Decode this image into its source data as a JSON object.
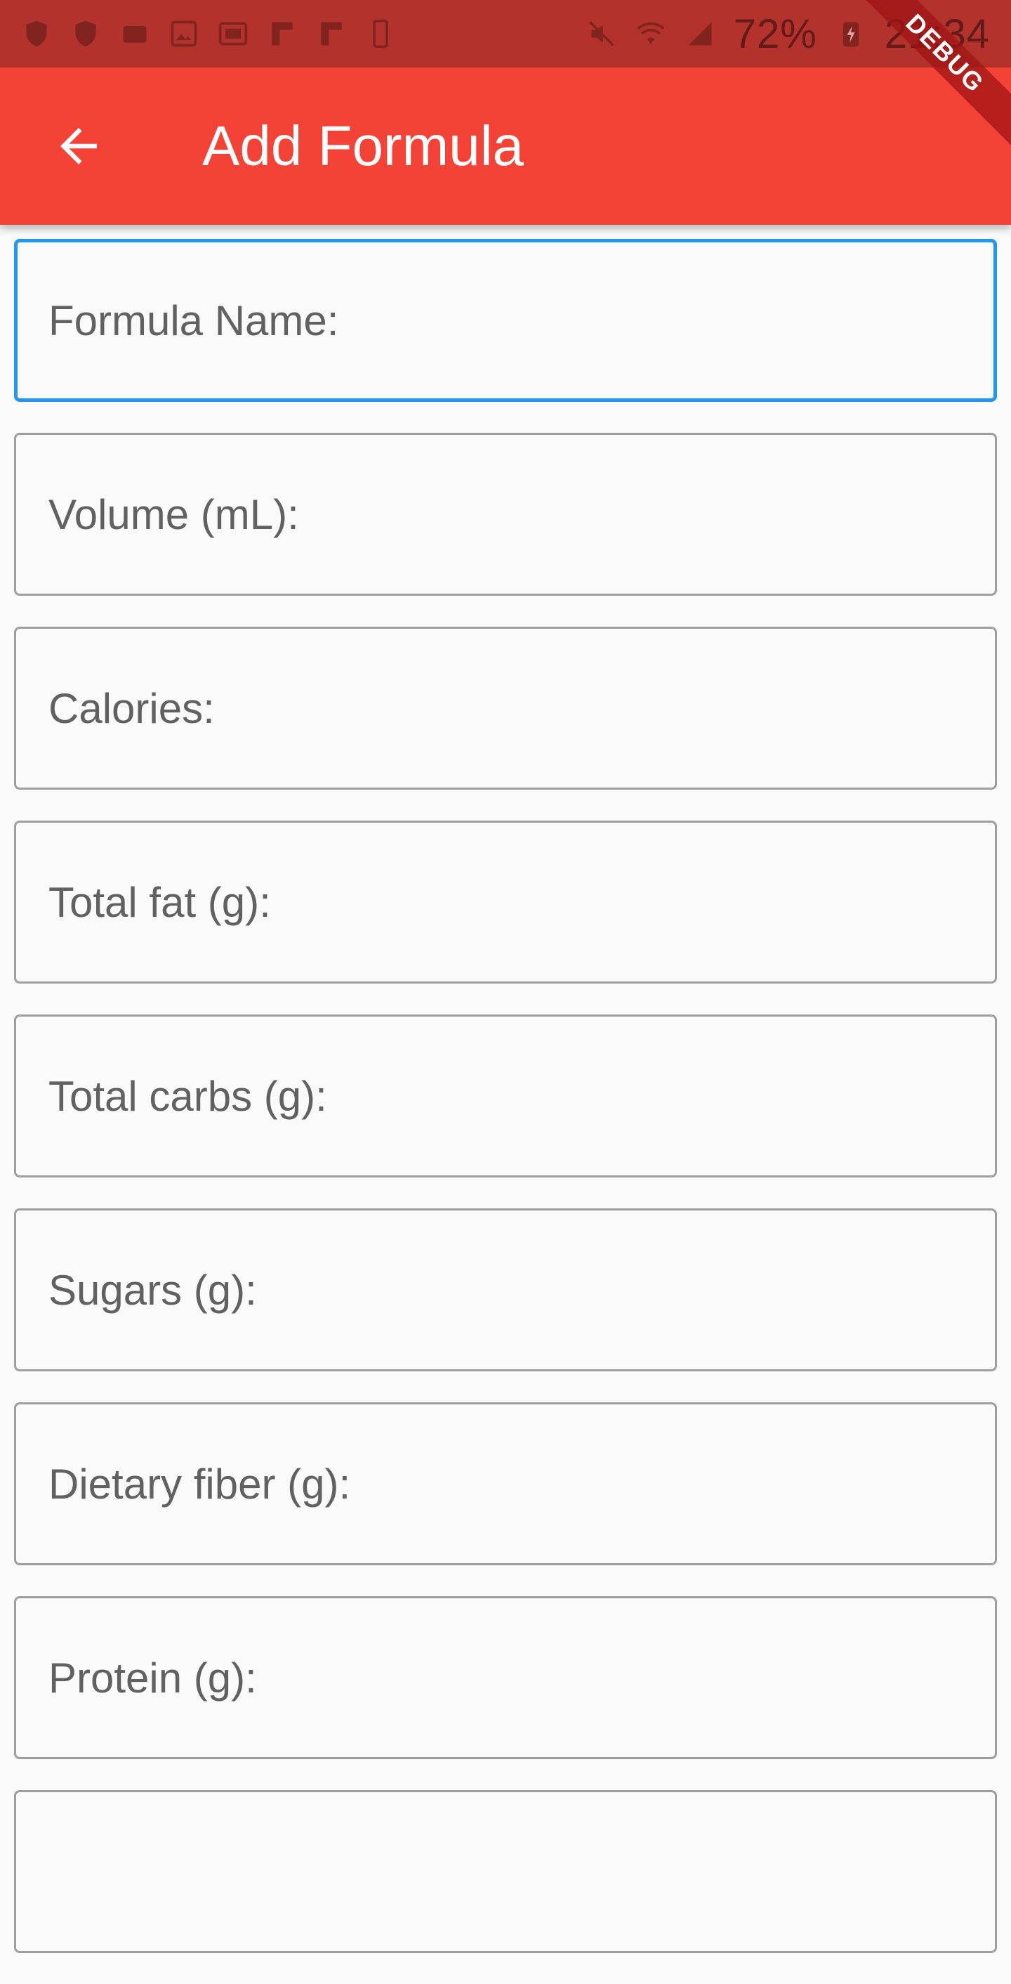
{
  "status_bar": {
    "battery": "72%",
    "time": "21:34"
  },
  "app_bar": {
    "title": "Add Formula",
    "back_icon": "arrow-back-icon"
  },
  "debug_banner": "DEBUG",
  "colors": {
    "app_bar": "#f44336",
    "status_bar": "#b3322c",
    "focus_border": "#2196f3",
    "field_border": "#9e9e9e"
  },
  "form": {
    "fields": [
      {
        "placeholder": "Formula Name:",
        "value": ""
      },
      {
        "placeholder": "Volume (mL):",
        "value": ""
      },
      {
        "placeholder": "Calories:",
        "value": ""
      },
      {
        "placeholder": "Total fat (g):",
        "value": ""
      },
      {
        "placeholder": "Total carbs (g):",
        "value": ""
      },
      {
        "placeholder": "Sugars (g):",
        "value": ""
      },
      {
        "placeholder": "Dietary fiber (g):",
        "value": ""
      },
      {
        "placeholder": "Protein (g):",
        "value": ""
      }
    ]
  }
}
